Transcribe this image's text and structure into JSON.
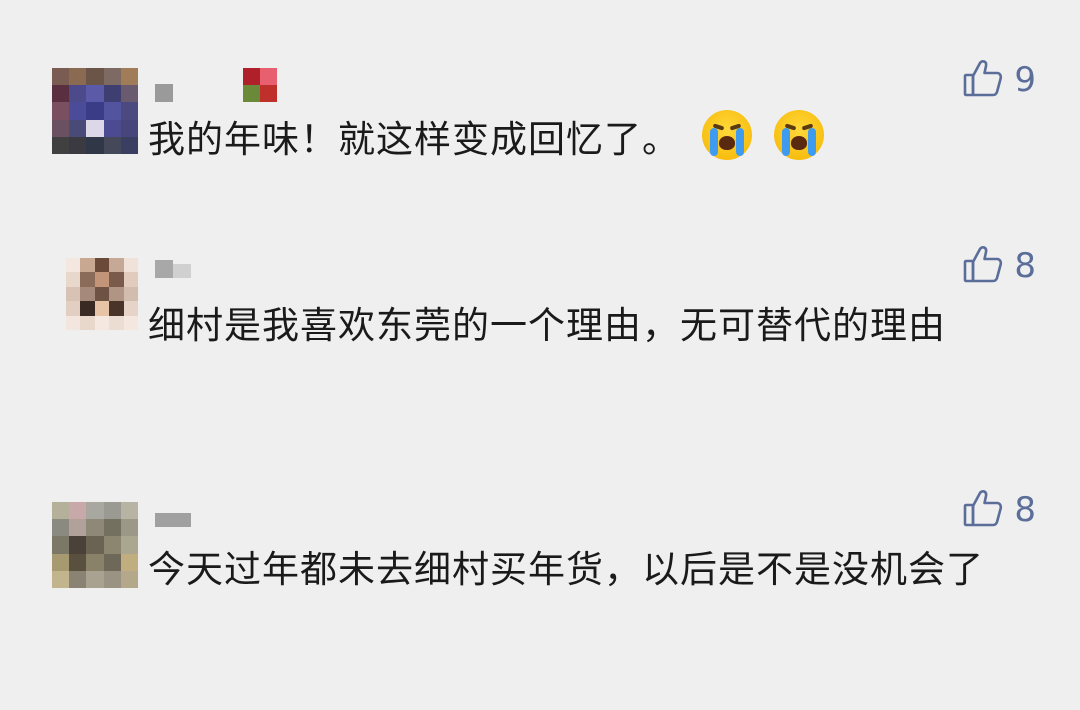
{
  "comments": [
    {
      "text": "我的年味！就这样变成回忆了。",
      "likes": "9",
      "emojis": [
        "loudly-crying-face",
        "loudly-crying-face"
      ]
    },
    {
      "text": "细村是我喜欢东莞的一个理由，无可替代的理由",
      "likes": "8"
    },
    {
      "text": "今天过年都未去细村买年货，以后是不是没机会了",
      "likes": "8"
    }
  ],
  "like_color": "#5b6e9a",
  "icons": {
    "like": "thumbs-up-icon",
    "emoji": "loudly-crying-face"
  }
}
